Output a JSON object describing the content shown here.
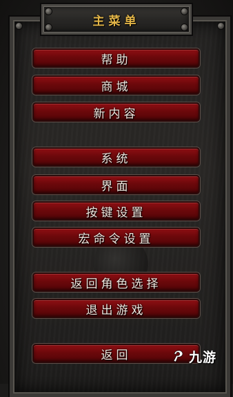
{
  "menu": {
    "title": "主菜单",
    "items": [
      {
        "label": "帮助"
      },
      {
        "label": "商城"
      },
      {
        "label": "新内容"
      },
      {
        "label": "系统"
      },
      {
        "label": "界面"
      },
      {
        "label": "按键设置"
      },
      {
        "label": "宏命令设置"
      },
      {
        "label": "返回角色选择"
      },
      {
        "label": "退出游戏"
      },
      {
        "label": "返回"
      }
    ]
  },
  "watermark": {
    "text": "九游",
    "icon": "9game-logo-icon"
  },
  "colors": {
    "title_text": "#e2b548",
    "button_red": "#7a0a0e",
    "frame_stone": "#3b3936"
  }
}
